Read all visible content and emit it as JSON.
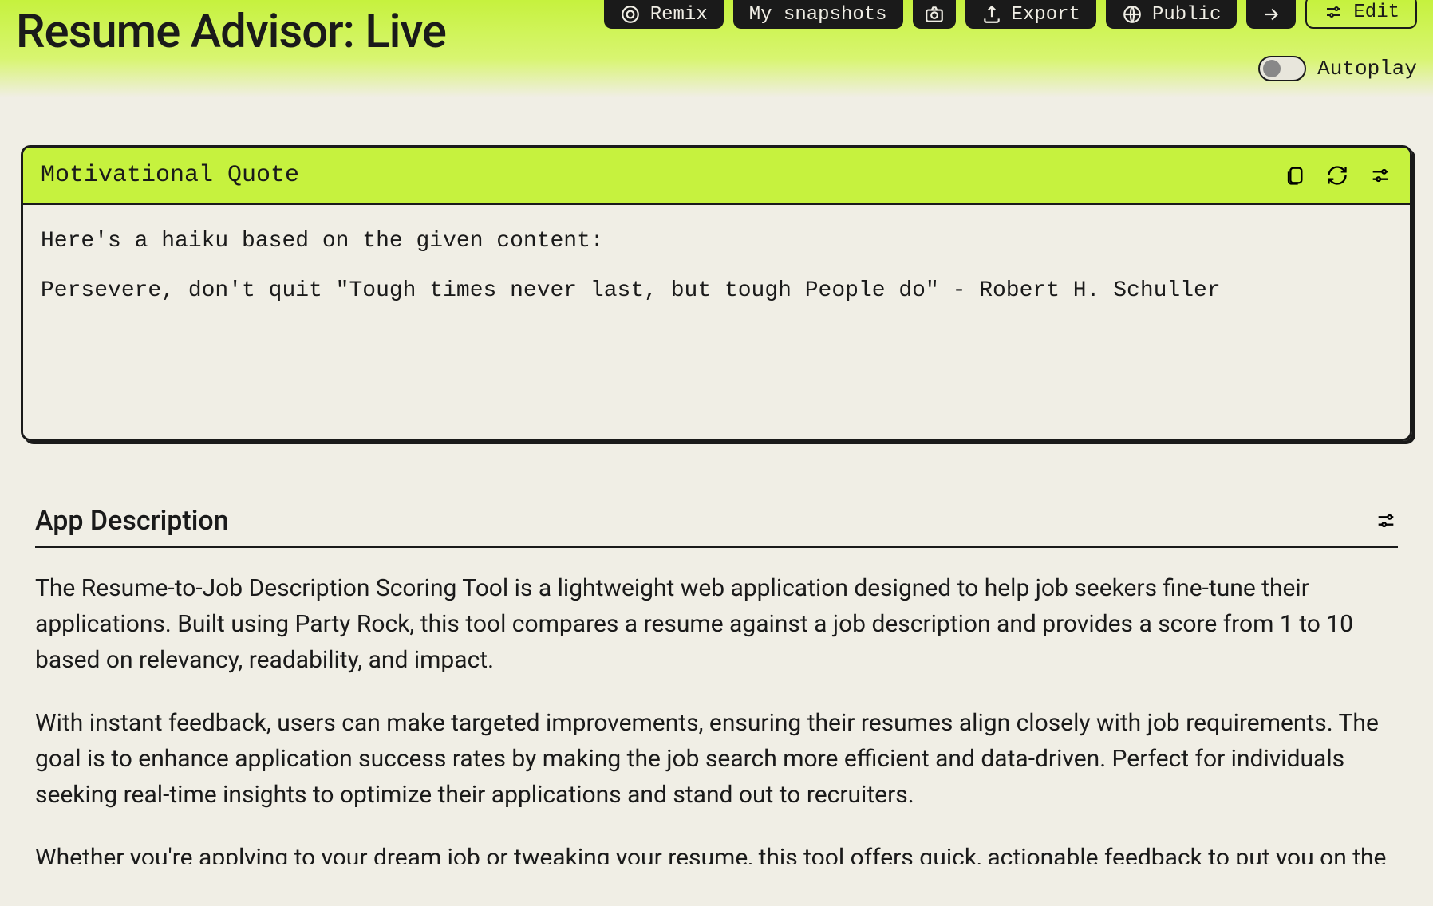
{
  "header": {
    "app_title": "Resume Advisor: Live",
    "remix_label": "Remix",
    "snapshots_label": "My snapshots",
    "export_label": "Export",
    "public_label": "Public",
    "edit_label": "Edit",
    "autoplay_label": "Autoplay"
  },
  "quote_card": {
    "title": "Motivational Quote",
    "line1": "Here's a haiku based on the given content:",
    "line2": "Persevere, don't quit \"Tough times never last, but tough People do\" - Robert H. Schuller"
  },
  "description": {
    "title": "App Description",
    "para1": "The Resume-to-Job Description Scoring Tool is a lightweight web application designed to help job seekers fine-tune their applications. Built using Party Rock, this tool compares a resume against a job description and provides a score from 1 to 10 based on relevancy, readability, and impact.",
    "para2": "With instant feedback, users can make targeted improvements, ensuring their resumes align closely with job requirements. The goal is to enhance application success rates by making the job search more efficient and data-driven. Perfect for individuals seeking real-time insights to optimize their applications and stand out to recruiters.",
    "para3": "Whether you're applying to your dream job or tweaking your resume, this tool offers quick, actionable feedback to put you on the"
  }
}
